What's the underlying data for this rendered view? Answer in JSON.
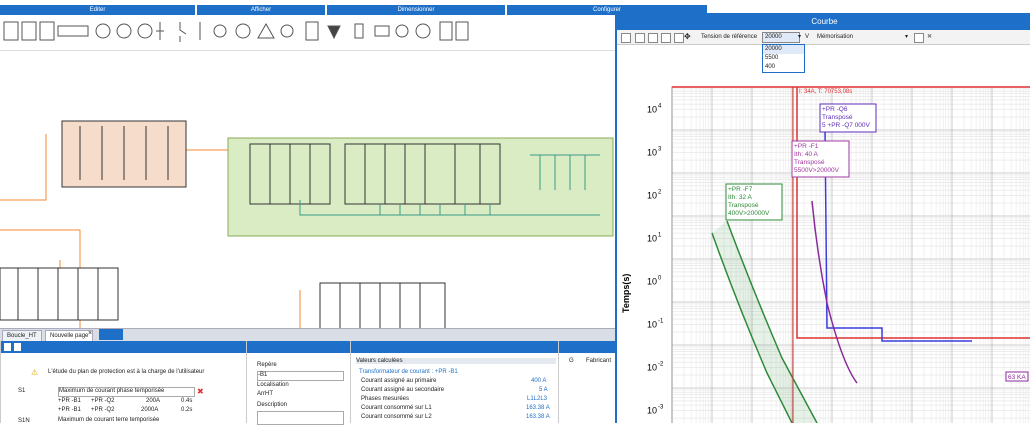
{
  "ribbon": {
    "groups": [
      {
        "label": "Editer"
      },
      {
        "label": "Afficher"
      },
      {
        "label": "Dimensionner"
      },
      {
        "label": "Configurer"
      }
    ]
  },
  "tabs": [
    {
      "label": "Boucle_HT"
    },
    {
      "label": "Nouvelle page"
    }
  ],
  "protection_panel": {
    "notice": "L'étude du plan de protection est à la charge de l'utilisateur",
    "rows": [
      {
        "code": "S1",
        "text": "Maximum de courant phase temporisée"
      },
      {
        "code": "",
        "a": "+PR -B1",
        "b": "+PR -Q2",
        "c": "200A",
        "d": "0.4s"
      },
      {
        "code": "",
        "a": "+PR -B1",
        "b": "+PR -Q2",
        "c": "2000A",
        "d": "0.2s"
      },
      {
        "code": "S1N",
        "text": "Maximum de courant terre temporisée"
      }
    ]
  },
  "properties_panel": {
    "repere_label": "Repère",
    "repere_value": "-B1",
    "localisation_label": "Localisation",
    "localisation_value": "ArrHT",
    "description_label": "Description"
  },
  "values_panel": {
    "header": "Valeurs calculées",
    "subheader": "Transformateur de courant : +PR -B1",
    "rows": [
      {
        "label": "Courant assigné au primaire",
        "value": "400 A"
      },
      {
        "label": "Courant assigné au secondaire",
        "value": "5 A"
      },
      {
        "label": "Phases mesurées",
        "value": "L1L2L3"
      },
      {
        "label": "Courant consommé sur L1",
        "value": "163.38 A"
      },
      {
        "label": "Courant consommé sur L2",
        "value": "163.38 A"
      }
    ]
  },
  "right_panel": {
    "col_g": "G",
    "col_fabricant": "Fabricant"
  },
  "courbe": {
    "title": "Courbe",
    "tension_label": "Tension de référence",
    "tension_value": "20000",
    "tension_unit": "V",
    "memorisation_label": "Mémorisation",
    "dropdown_options": [
      "20000",
      "5500",
      "400"
    ],
    "ylabel": "Temps(s)",
    "yticks": [
      "10",
      "10",
      "10",
      "10",
      "10",
      "10",
      "10",
      "10"
    ],
    "yexp": [
      "4",
      "3",
      "2",
      "1",
      "0",
      "-1",
      "-2",
      "-3"
    ],
    "marker_text": "I: 34A, T: 70753,08s",
    "annotations": [
      {
        "lines": [
          "+PR -Q6",
          "Transposé",
          "5 +PR -Q7 000V"
        ],
        "color": "#5b2db8"
      },
      {
        "lines": [
          "+PR -F1",
          "Ith: 40 A",
          "Transposé",
          "5500V>20000V"
        ],
        "color": "#a0379e"
      },
      {
        "lines": [
          "+PR -F7",
          "Ith: 32 A",
          "Transposé",
          "400V>20000V"
        ],
        "color": "#2e8b3a"
      }
    ],
    "right_label": "63 KA"
  },
  "colors": {
    "accent": "#1e6fc8",
    "red": "#e03030",
    "blue": "#3b3bdc",
    "purple": "#8a2a9b",
    "green": "#2e8b3a"
  }
}
